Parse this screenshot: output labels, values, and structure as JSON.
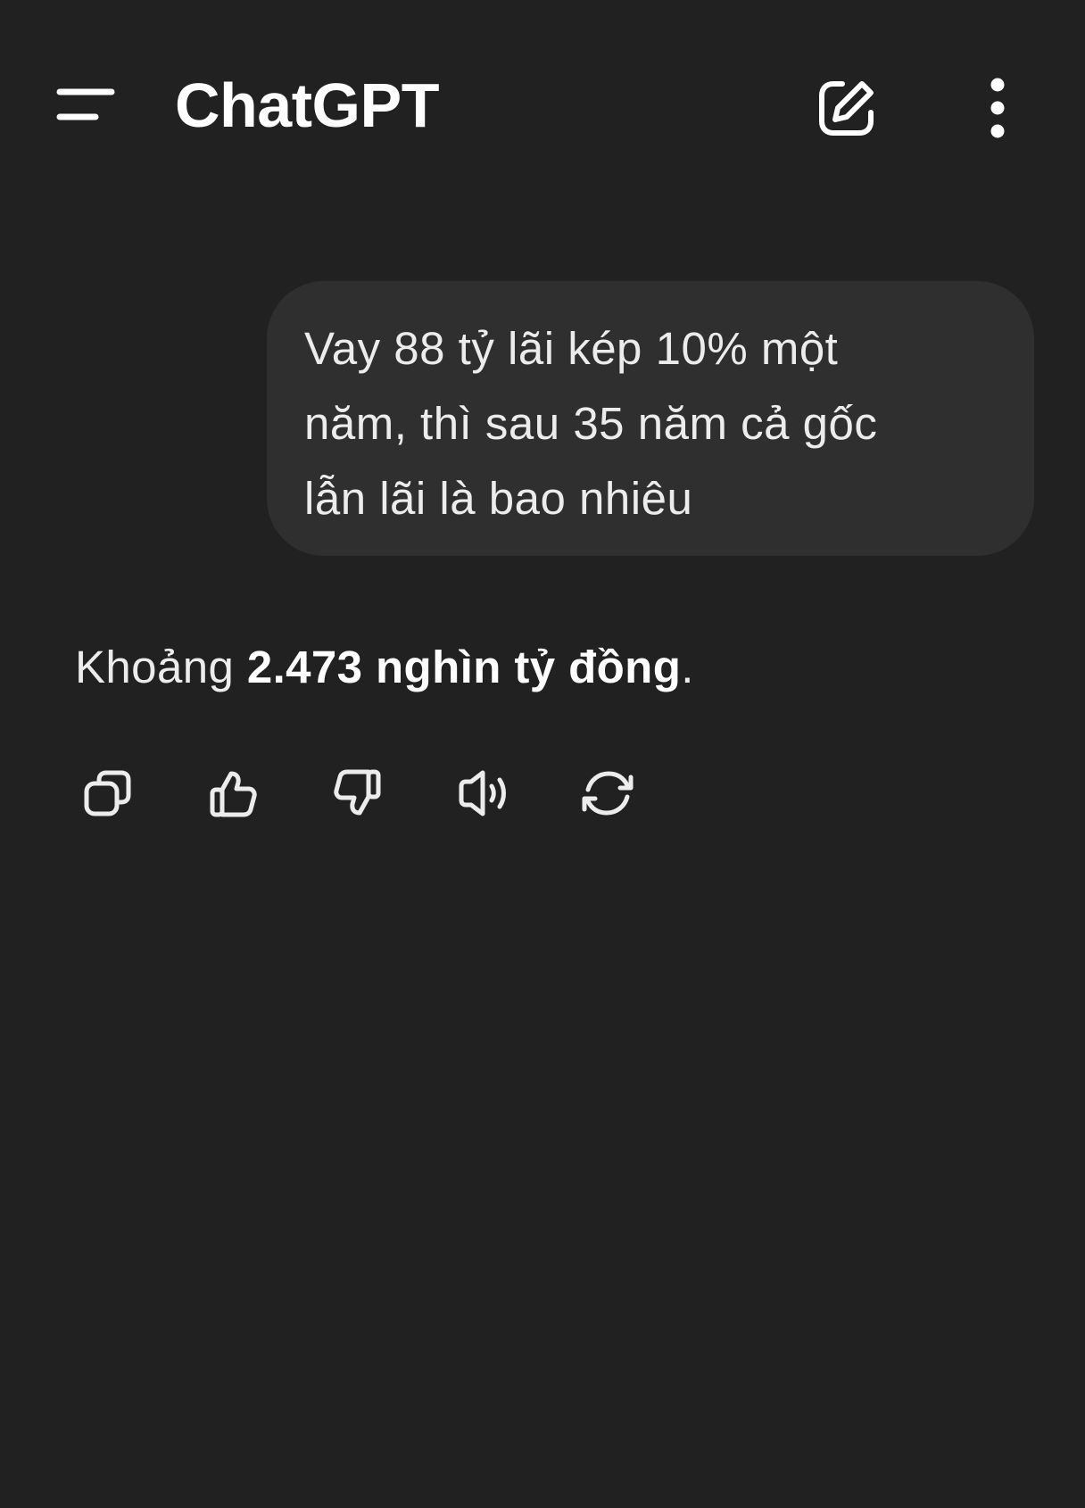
{
  "header": {
    "title": "ChatGPT",
    "menu_icon": "menu-icon",
    "new_chat_icon": "new-chat-icon",
    "more_icon": "more-vertical-icon"
  },
  "conversation": {
    "user_message": "Vay 88 tỷ lãi kép 10% một\nnăm, thì sau 35 năm cả gốc\nlẫn lãi là bao nhiêu",
    "assistant_message": {
      "prefix": "Khoảng ",
      "bold": "2.473 nghìn tỷ đồng",
      "suffix": "."
    }
  },
  "message_actions": [
    {
      "name": "copy",
      "icon": "copy-icon"
    },
    {
      "name": "thumbs-up",
      "icon": "thumbs-up-icon"
    },
    {
      "name": "thumbs-down",
      "icon": "thumbs-down-icon"
    },
    {
      "name": "read-aloud",
      "icon": "speaker-icon"
    },
    {
      "name": "regenerate",
      "icon": "refresh-icon"
    }
  ],
  "colors": {
    "background": "#212121",
    "bubble": "#2f2f2f",
    "text": "#ececec",
    "title": "#ffffff"
  }
}
